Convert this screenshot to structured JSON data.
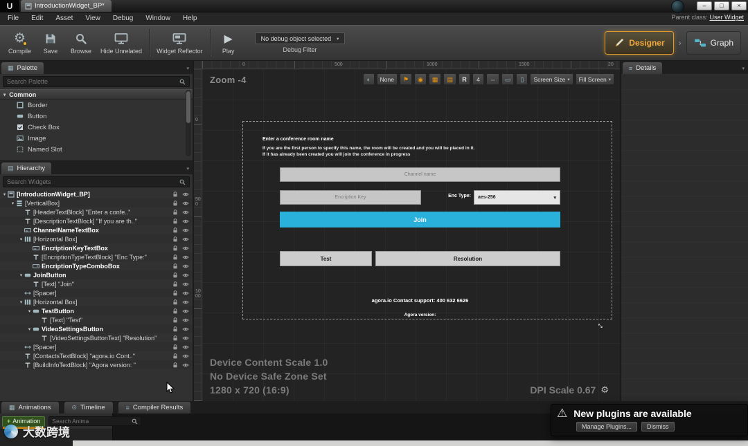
{
  "icons": {
    "unreal_logo": "U",
    "minimize": "–",
    "maximize": "□",
    "close": "×",
    "gear": "⚙",
    "play": "▶",
    "caret": "▾",
    "expand": "▾",
    "chevron": "›",
    "warning": "⚠",
    "globe": "◐",
    "flag": "⚑",
    "target": "◉",
    "grid": "▦",
    "rows": "▤",
    "lines": "≡",
    "arrows": "⇔",
    "landscape": "▭",
    "portrait": "▯",
    "resize": "↔",
    "plus": "+"
  },
  "window": {
    "tab_title": "IntroductionWidget_BP*",
    "parent_class_label": "Parent class:",
    "parent_class_value": "User Widget",
    "menu_items": [
      "File",
      "Edit",
      "Asset",
      "View",
      "Debug",
      "Window",
      "Help"
    ]
  },
  "toolbar": {
    "compile_label": "Compile",
    "save_label": "Save",
    "browse_label": "Browse",
    "hide_unrelated_label": "Hide Unrelated",
    "widget_reflector_label": "Widget Reflector",
    "play_label": "Play",
    "debug_object_label": "No debug object selected",
    "debug_filter_label": "Debug Filter",
    "designer_label": "Designer",
    "graph_label": "Graph"
  },
  "palette": {
    "title": "Palette",
    "search_placeholder": "Search Palette",
    "section_label": "Common",
    "items": [
      {
        "label": "Border",
        "icon": "border"
      },
      {
        "label": "Button",
        "icon": "button"
      },
      {
        "label": "Check Box",
        "icon": "checkbox"
      },
      {
        "label": "Image",
        "icon": "image"
      },
      {
        "label": "Named Slot",
        "icon": "slot"
      }
    ]
  },
  "hierarchy": {
    "title": "Hierarchy",
    "search_placeholder": "Search Widgets",
    "items": [
      {
        "label": "[IntroductionWidget_BP]",
        "depth": 0,
        "expand": true,
        "bold": true,
        "icon": "root"
      },
      {
        "label": "[VerticalBox]",
        "depth": 1,
        "expand": true,
        "icon": "vbox"
      },
      {
        "label": "[HeaderTextBlock] \"Enter a confe..\"",
        "depth": 2,
        "icon": "text"
      },
      {
        "label": "[DescriptionTextBlock] \"If you are th..\"",
        "depth": 2,
        "icon": "text"
      },
      {
        "label": "ChannelNameTextBox",
        "depth": 2,
        "bold": true,
        "icon": "textbox"
      },
      {
        "label": "[Horizontal Box]",
        "depth": 2,
        "expand": true,
        "icon": "hbox"
      },
      {
        "label": "EncriptionKeyTextBox",
        "depth": 3,
        "bold": true,
        "icon": "textbox"
      },
      {
        "label": "[EncriptionTypeTextBlock] \"Enc Type:\"",
        "depth": 3,
        "icon": "text"
      },
      {
        "label": "EncriptionTypeComboBox",
        "depth": 3,
        "bold": true,
        "icon": "combo"
      },
      {
        "label": "JoinButton",
        "depth": 2,
        "expand": true,
        "bold": true,
        "icon": "button"
      },
      {
        "label": "[Text] \"Join\"",
        "depth": 3,
        "icon": "text"
      },
      {
        "label": "[Spacer]",
        "depth": 2,
        "icon": "spacer"
      },
      {
        "label": "[Horizontal Box]",
        "depth": 2,
        "expand": true,
        "icon": "hbox"
      },
      {
        "label": "TestButton",
        "depth": 3,
        "expand": true,
        "bold": true,
        "icon": "button"
      },
      {
        "label": "[Text] \"Test\"",
        "depth": 4,
        "icon": "text"
      },
      {
        "label": "VideoSettingsButton",
        "depth": 3,
        "expand": true,
        "bold": true,
        "icon": "button"
      },
      {
        "label": "[VideoSettingsButtonText] \"Resolution\"",
        "depth": 4,
        "icon": "text"
      },
      {
        "label": "[Spacer]",
        "depth": 2,
        "icon": "spacer"
      },
      {
        "label": "[ContactsTextBlock] \"agora.io Cont..\"",
        "depth": 2,
        "icon": "text"
      },
      {
        "label": "[BuildInfoTextBlock] \"Agora version: \"",
        "depth": 2,
        "icon": "text"
      }
    ]
  },
  "designer": {
    "zoom_label": "Zoom -4",
    "ruler_top": [
      "0",
      "500",
      "1000",
      "1500",
      "20"
    ],
    "ruler_left": [
      "0",
      "500",
      "1000"
    ],
    "toolbar": {
      "none_label": "None",
      "r_label": "R",
      "grid_snap": "4",
      "screen_size_label": "Screen Size",
      "fill_screen_label": "Fill Screen"
    },
    "canvas": {
      "heading": "Enter a conference room name",
      "desc_line1": "If you are the first person to specify this name, the room will be created and you will be placed in it.",
      "desc_line2": "If it has already been created you will join the conference in progress",
      "channel_placeholder": "Channel name",
      "encription_placeholder": "Encription Key",
      "enc_type_label": "Enc Type:",
      "enc_type_value": "aes-256",
      "join_label": "Join",
      "test_label": "Test",
      "resolution_label": "Resolution",
      "contact_text": "agora.io Contact support: 400 632 6626",
      "version_text": "Agora version:"
    },
    "status": {
      "content_scale": "Device Content Scale 1.0",
      "safe_zone": "No Device Safe Zone Set",
      "resolution": "1280 x 720 (16:9)",
      "dpi_scale": "DPI Scale 0.67"
    }
  },
  "details": {
    "title": "Details"
  },
  "bottom": {
    "tabs": [
      "Animations",
      "Timeline",
      "Compiler Results"
    ],
    "add_animation_label": "Animation",
    "search_placeholder": "Search Anima",
    "watermark": "大数跨境"
  },
  "notification": {
    "title": "New plugins are available",
    "manage_label": "Manage Plugins...",
    "dismiss_label": "Dismiss"
  },
  "colors": {
    "accent_orange": "#e8940f",
    "join_blue": "#29b1dc",
    "plus_green": "#8fd45f"
  }
}
